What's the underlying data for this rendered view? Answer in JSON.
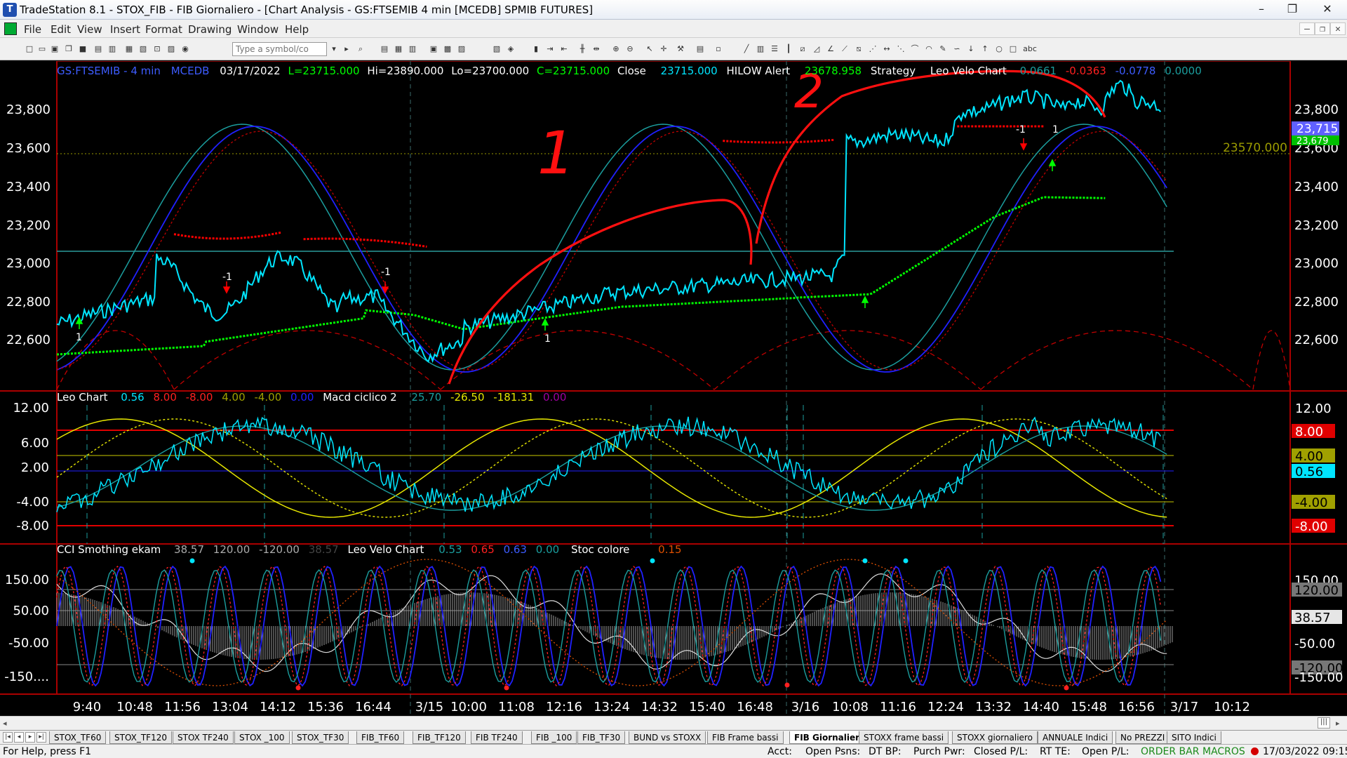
{
  "window": {
    "title": "TradeStation 8.1 - STOX_FIB - FIB Giornaliero - [Chart Analysis - GS:FTSEMIB  4 min  [MCEDB] SPMIB FUTURES]",
    "min": "–",
    "max": "❐",
    "close": "✕"
  },
  "menu": [
    "File",
    "Edit",
    "View",
    "Insert",
    "Format",
    "Drawing",
    "Window",
    "Help"
  ],
  "toolbar": {
    "symbol_placeholder": "Type a symbol/co"
  },
  "chart": {
    "header": {
      "symbol": "GS:FTSEMIB - 4 min",
      "source": "MCEDB",
      "date": "03/17/2022",
      "last": "L=23715.000",
      "high": "Hi=23890.000",
      "low": "Lo=23700.000",
      "close_val": "C=23715.000",
      "close_label": "Close",
      "close_num": "23715.000",
      "hilow_label": "HILOW Alert",
      "hilow_val": "23678.958",
      "strategy": "Strategy",
      "leo_velo": "Leo Velo Chart",
      "lv1": "0.0661",
      "lv2": "-0.0363",
      "lv3": "-0.0778",
      "lv4": "0.0000"
    },
    "price_axis": [
      "23,800",
      "23,600",
      "23,400",
      "23,200",
      "23,000",
      "22,800",
      "22,600"
    ],
    "last_price_box": "23,715",
    "hidden_price_box": "23,679",
    "hline_label": "23570.000",
    "annotations": [
      "1",
      "2"
    ],
    "signal_labels": {
      "minus_one": "-1",
      "one": "1"
    },
    "xaxis": [
      "9:40",
      "10:48",
      "11:56",
      "13:04",
      "14:12",
      "15:36",
      "16:44",
      "3/15",
      "10:00",
      "11:08",
      "12:16",
      "13:24",
      "14:32",
      "15:40",
      "16:48",
      "3/16",
      "10:08",
      "11:16",
      "12:24",
      "13:32",
      "14:40",
      "15:48",
      "16:56",
      "3/17",
      "10:12"
    ],
    "colors": {
      "up": "#00ff00",
      "price": "#00e5ff",
      "red": "#ff0000",
      "blue": "#2020ff",
      "teal": "#1b9e9e",
      "yellow": "#e6e600"
    }
  },
  "macd_panel": {
    "header": {
      "name": "Leo Chart",
      "v1": "0.56",
      "v2": "8.00",
      "v3": "-8.00",
      "v4": "4.00",
      "v5": "-4.00",
      "v6": "0.00",
      "name2": "Macd ciclico 2",
      "w1": "25.70",
      "w2": "-26.50",
      "w3": "-181.31",
      "w4": "0.00"
    },
    "axis": [
      "12.00",
      "6.00",
      "2.00",
      "-4.00",
      "-8.00"
    ],
    "right_boxes": {
      "b12": "12.00",
      "b8": "8.00",
      "b4": "4.00",
      "b2": "2.00",
      "b056": "0.56",
      "bm4": "-4.00",
      "bm8": "-8.00"
    }
  },
  "cci_panel": {
    "header": {
      "name": "CCI Smothing ekam",
      "v1": "38.57",
      "v2": "120.00",
      "v3": "-120.00",
      "v4": "38.57",
      "name2": "Leo Velo Chart",
      "w1": "0.53",
      "w2": "0.65",
      "w3": "0.63",
      "w4": "0.00",
      "name3": "Stoc colore",
      "s1": "0.15"
    },
    "axis": [
      "150.00",
      "50.00",
      "-50.00",
      "-150...."
    ],
    "right_boxes": {
      "b150": "150.00",
      "b120": "120.00",
      "b3857": "38.57",
      "bm50": "-50.00",
      "bm120": "-120.00",
      "bm150": "-150.00"
    }
  },
  "tabs": [
    "STOX_TF60",
    "STOX_TF120",
    "STOX TF240",
    "STOX _100",
    "STOX_TF30",
    "FIB_TF60",
    "FIB_TF120",
    "FIB TF240",
    "FIB _100",
    "FIB_TF30",
    "BUND vs STOXX",
    "FIB Frame bassi",
    "FIB Giornaliero",
    "STOXX frame bassi",
    "STOXX giornaliero",
    "ANNUALE Indici",
    "No PREZZI",
    "SITO Indici"
  ],
  "active_tab": "FIB Giornaliero",
  "status": {
    "help": "For Help, press F1",
    "acct": "Acct:",
    "open_psns": "Open Psns:",
    "dt_bp": "DT BP:",
    "purch_pwr": "Purch Pwr:",
    "closed_pl": "Closed P/L:",
    "rt_te": "RT TE:",
    "open_pl": "Open P/L:",
    "order_bar": "ORDER BAR",
    "macros": "MACROS",
    "datetime": "17/03/2022 09:15"
  }
}
